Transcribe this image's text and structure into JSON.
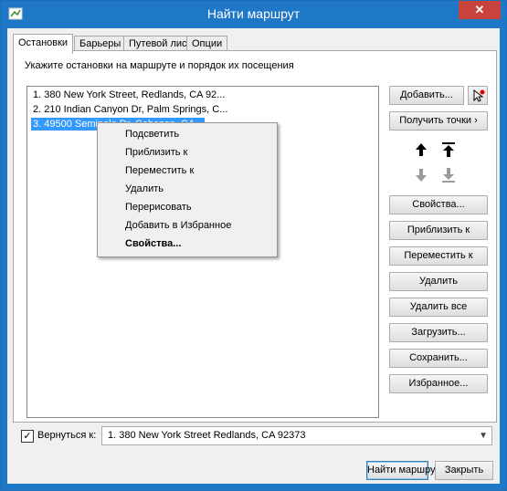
{
  "window": {
    "title": "Найти маршрут",
    "close_label": "✕"
  },
  "tabs": [
    "Остановки",
    "Барьеры",
    "Путевой лист",
    "Опции"
  ],
  "instruction": "Укажите остановки на маршруте и порядок их посещения",
  "stops": [
    "1. 380 New York Street, Redlands, CA 92...",
    "2. 210 Indian Canyon Dr, Palm Springs, C...",
    "3. 49500 Seminole Dr, Cabazon, CA"
  ],
  "context_menu": [
    "Подсветить",
    "Приблизить к",
    "Переместить к",
    "Удалить",
    "Перерисовать",
    "Добавить в Избранное",
    "Свойства..."
  ],
  "buttons": {
    "add": "Добавить...",
    "get_points": "Получить точки",
    "get_points_arrow": "›",
    "properties": "Свойства...",
    "zoom_to": "Приблизить к",
    "pan_to": "Переместить к",
    "remove": "Удалить",
    "remove_all": "Удалить все",
    "load": "Загрузить...",
    "save": "Сохранить...",
    "favorites": "Избранное...",
    "find_route": "Найти маршрут",
    "close": "Закрыть"
  },
  "return_to": {
    "label": "Вернуться к:",
    "checked": true,
    "check_glyph": "✓",
    "value": "1. 380 New York Street Redlands, CA 92373",
    "dropdown_glyph": "▼"
  }
}
